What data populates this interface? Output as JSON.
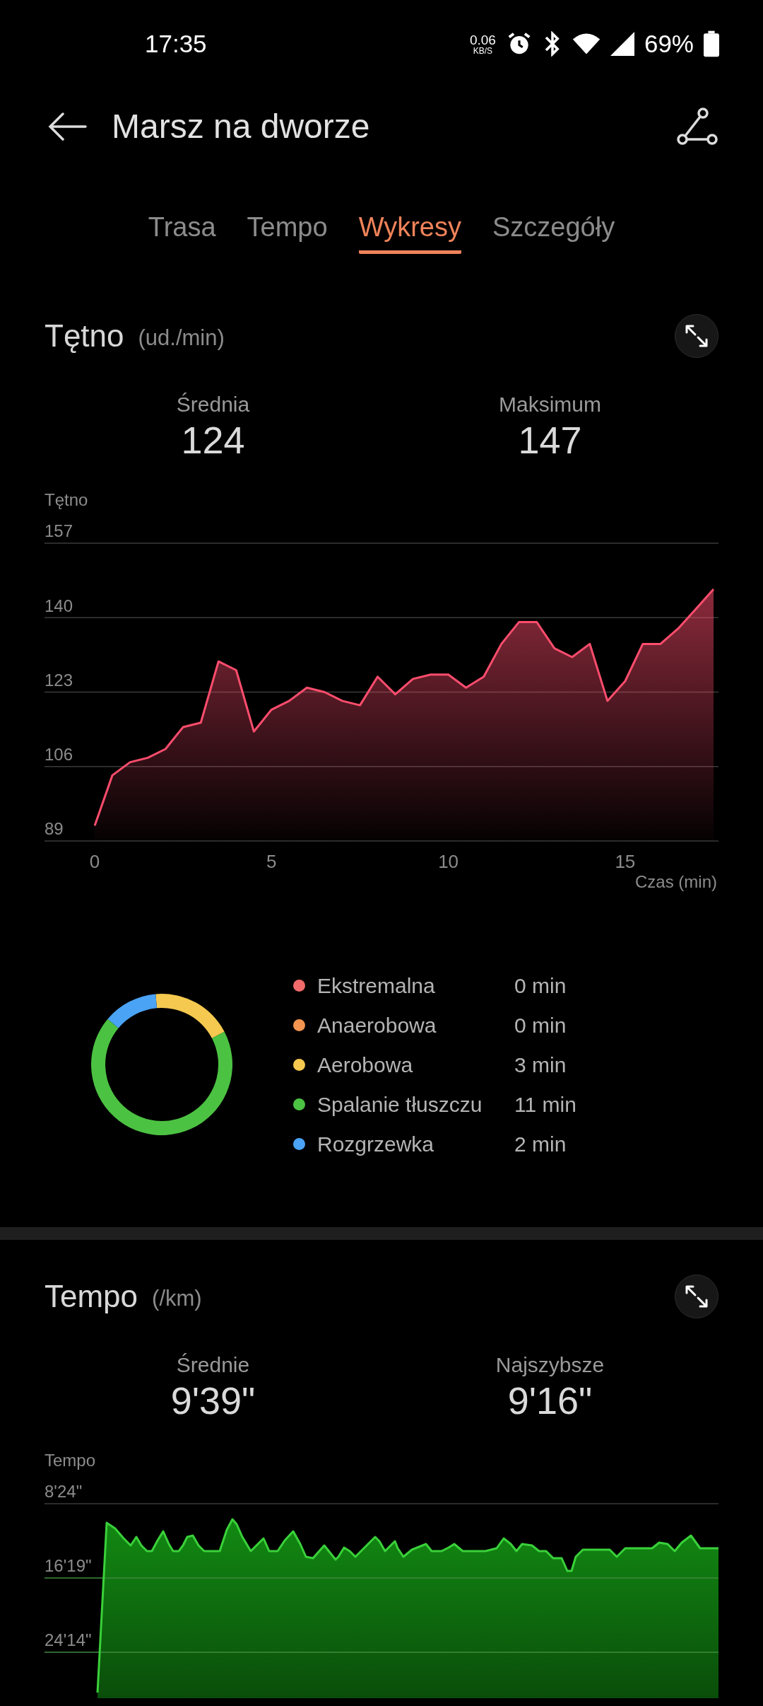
{
  "status_bar": {
    "time": "17:35",
    "net_speed": "0.06",
    "net_unit": "KB/S",
    "battery": "69%"
  },
  "header": {
    "title": "Marsz na dworze"
  },
  "tabs": [
    {
      "label": "Trasa",
      "selected": false
    },
    {
      "label": "Tempo",
      "selected": false
    },
    {
      "label": "Wykresy",
      "selected": true
    },
    {
      "label": "Szczegóły",
      "selected": false
    }
  ],
  "sections": [
    {
      "title": "Tętno",
      "unit": "(ud./min)",
      "stats": [
        {
          "label": "Średnia",
          "value": "124"
        },
        {
          "label": "Maksimum",
          "value": "147"
        }
      ],
      "chart_data": {
        "type": "area",
        "ylabel": "Tętno",
        "xlabel": "Czas (min)",
        "x": [
          0,
          0.5,
          1,
          1.5,
          2,
          2.5,
          3,
          3.5,
          4,
          4.5,
          5,
          5.5,
          6,
          6.5,
          7,
          7.5,
          8,
          8.5,
          9,
          9.5,
          10,
          10.5,
          11,
          11.5,
          12,
          12.5,
          13,
          13.5,
          14,
          14.5,
          15,
          15.5,
          16,
          16.5,
          17,
          17.5
        ],
        "series": [
          {
            "type": "area",
            "color": "#ff4d6d",
            "values": [
              92.5,
              104,
              107,
              108,
              110,
              115,
              116,
              130,
              128,
              114,
              119,
              121,
              124,
              123,
              121,
              120,
              126.5,
              122.5,
              126,
              127,
              127,
              124,
              126.5,
              134,
              139,
              139,
              133,
              131,
              134,
              121,
              125.5,
              134,
              134,
              137.5,
              142,
              146.5
            ]
          }
        ],
        "xlim": [
          -1.42,
          17.64
        ],
        "ylim": [
          89,
          157
        ],
        "xticks": [
          0,
          5,
          10,
          15
        ],
        "yticks": [
          89,
          106,
          123,
          140,
          157
        ],
        "grid": true
      },
      "zones": {
        "legend": [
          {
            "name": "Ekstremalna",
            "duration": "0 min",
            "color": "#f26b6b"
          },
          {
            "name": "Anaerobowa",
            "duration": "0 min",
            "color": "#f39550"
          },
          {
            "name": "Aerobowa",
            "duration": "3 min",
            "color": "#f5c94f"
          },
          {
            "name": "Spalanie tłuszczu",
            "duration": "11 min",
            "color": "#4cc243"
          },
          {
            "name": "Rozgrzewka",
            "duration": "2 min",
            "color": "#4aa3f5"
          }
        ],
        "chart_data": {
          "type": "donut",
          "values": [
            0,
            0,
            18.75,
            68.75,
            12.5
          ]
        }
      }
    },
    {
      "title": "Tempo",
      "unit": "(/km)",
      "stats": [
        {
          "label": "Średnie",
          "value": "9'39\""
        },
        {
          "label": "Najszybsze",
          "value": "9'16\""
        }
      ],
      "chart": {
        "kind": "picture",
        "ylabel": "Tempo",
        "tick_labels": [
          "8'24\"",
          "16'19\"",
          "24'14\""
        ]
      }
    }
  ]
}
